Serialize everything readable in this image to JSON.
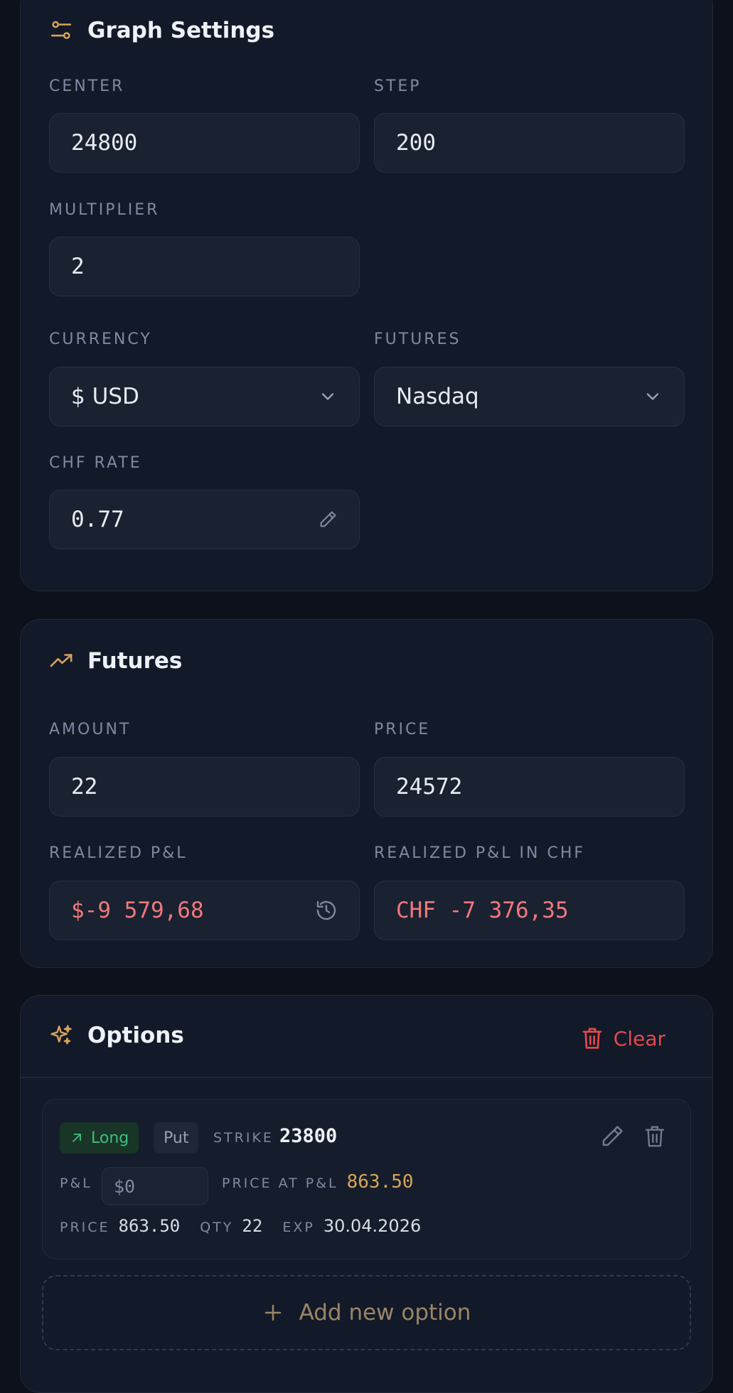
{
  "graph_settings": {
    "title": "Graph Settings",
    "icon": "sliders-icon",
    "center": {
      "label": "CENTER",
      "value": "24800"
    },
    "step": {
      "label": "STEP",
      "value": "200"
    },
    "multiplier": {
      "label": "MULTIPLIER",
      "value": "2"
    },
    "currency": {
      "label": "CURRENCY",
      "value": "$ USD"
    },
    "futures": {
      "label": "FUTURES",
      "value": "Nasdaq"
    },
    "chf_rate": {
      "label": "CHF RATE",
      "value": "0.77"
    }
  },
  "futures": {
    "title": "Futures",
    "icon": "trending-up-icon",
    "amount": {
      "label": "AMOUNT",
      "value": "22"
    },
    "price": {
      "label": "PRICE",
      "value": "24572"
    },
    "realized_pl": {
      "label": "REALIZED P&L",
      "value": "$-9 579,68"
    },
    "realized_pl_chf": {
      "label": "REALIZED P&L IN CHF",
      "value": "CHF -7 376,35"
    }
  },
  "options": {
    "title": "Options",
    "icon": "sparkles-icon",
    "clear_label": "Clear",
    "items": [
      {
        "direction": "Long",
        "type": "Put",
        "strike_label": "STRIKE",
        "strike": "23800",
        "pl_label": "P&L",
        "pl_value": "$0",
        "price_at_pl_label": "PRICE AT P&L",
        "price_at_pl": "863.50",
        "price_label": "PRICE",
        "price": "863.50",
        "qty_label": "QTY",
        "qty": "22",
        "exp_label": "EXP",
        "exp": "30.04.2026"
      }
    ],
    "add_label": "Add new option"
  },
  "colors": {
    "accent": "#d6a45a",
    "negative": "#f0787c",
    "long": "#3fbf7f",
    "danger": "#e5484d"
  }
}
